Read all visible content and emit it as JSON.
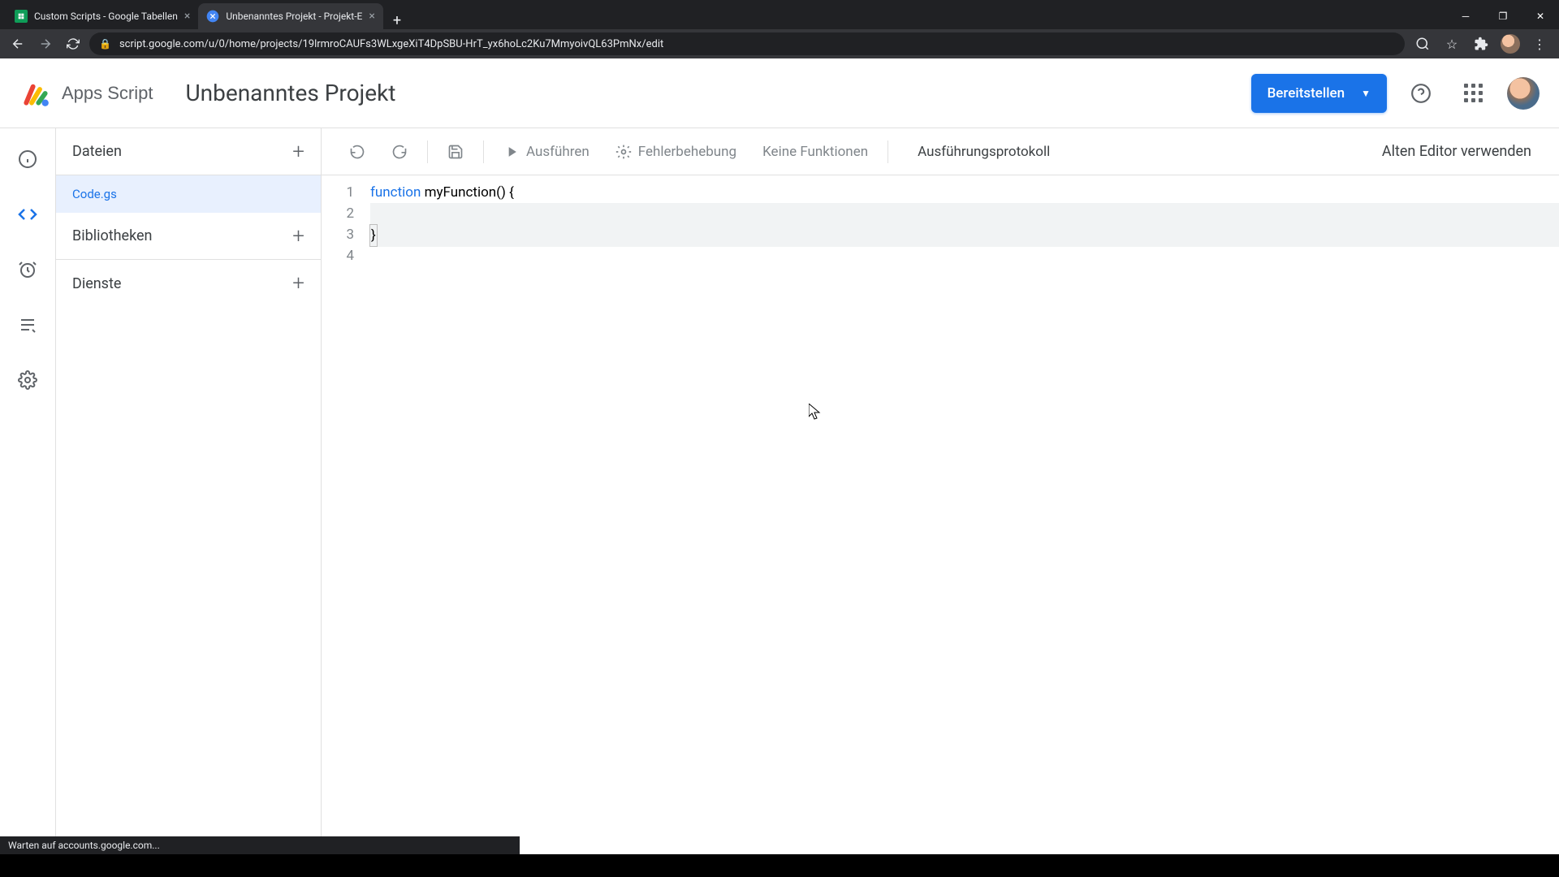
{
  "browser": {
    "tabs": [
      {
        "title": "Custom Scripts - Google Tabellen"
      },
      {
        "title": "Unbenanntes Projekt - Projekt-E"
      }
    ],
    "url": "script.google.com/u/0/home/projects/19lrmroCAUFs3WLxgeXiT4DpSBU-HrT_yx6hoLc2Ku7MmyoivQL63PmNx/edit"
  },
  "header": {
    "app_name": "Apps Script",
    "project_title": "Unbenanntes Projekt",
    "deploy_label": "Bereitstellen"
  },
  "sidebar": {
    "files_label": "Dateien",
    "libraries_label": "Bibliotheken",
    "services_label": "Dienste",
    "file_name": "Code.gs"
  },
  "toolbar": {
    "run_label": "Ausführen",
    "debug_label": "Fehlerbehebung",
    "nofunc_label": "Keine Funktionen",
    "log_label": "Ausführungsprotokoll",
    "legacy_label": "Alten Editor verwenden"
  },
  "code": {
    "line_numbers": [
      "1",
      "2",
      "3",
      "4"
    ],
    "line1_kw": "function",
    "line1_rest": " myFunction() {",
    "line2": "  ",
    "line3": "}",
    "line4": ""
  },
  "status": "Warten auf accounts.google.com..."
}
